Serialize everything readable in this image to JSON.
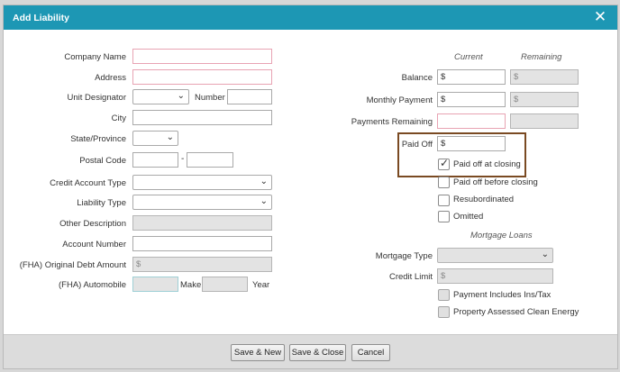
{
  "dialog": {
    "title": "Add Liability",
    "close_glyph": "✕"
  },
  "left": {
    "company_name_label": "Company Name",
    "address_label": "Address",
    "unit_designator_label": "Unit Designator",
    "number_label": "Number",
    "city_label": "City",
    "state_label": "State/Province",
    "postal_code_label": "Postal Code",
    "postal_dash": "-",
    "credit_account_type_label": "Credit Account Type",
    "liability_type_label": "Liability Type",
    "other_description_label": "Other Description",
    "account_number_label": "Account Number",
    "fha_original_debt_label": "(FHA) Original Debt Amount",
    "fha_original_debt_value": "$",
    "fha_automobile_label": "(FHA) Automobile",
    "make_label": "Make",
    "year_label": "Year"
  },
  "right": {
    "current_header": "Current",
    "remaining_header": "Remaining",
    "balance_label": "Balance",
    "balance_current": "$",
    "balance_remaining": "$",
    "monthly_payment_label": "Monthly Payment",
    "monthly_current": "$",
    "monthly_remaining": "$",
    "payments_remaining_label": "Payments Remaining",
    "paid_off_label": "Paid Off",
    "paid_off_value": "$",
    "paid_off_at_closing_label": "Paid off at closing",
    "paid_off_before_closing_label": "Paid off before closing",
    "resubordinated_label": "Resubordinated",
    "omitted_label": "Omitted",
    "mortgage_loans_header": "Mortgage Loans",
    "mortgage_type_label": "Mortgage Type",
    "credit_limit_label": "Credit Limit",
    "credit_limit_value": "$",
    "payment_includes_label": "Payment Includes Ins/Tax",
    "pace_label": "Property Assessed Clean Energy"
  },
  "footer": {
    "save_new": "Save & New",
    "save_close": "Save & Close",
    "cancel": "Cancel"
  },
  "icons": {
    "chevron": "⌄",
    "check": "✓"
  },
  "colors": {
    "titlebar": "#1d97b4",
    "required_border": "#e8a3b3",
    "highlight_border": "#7a4a22"
  }
}
